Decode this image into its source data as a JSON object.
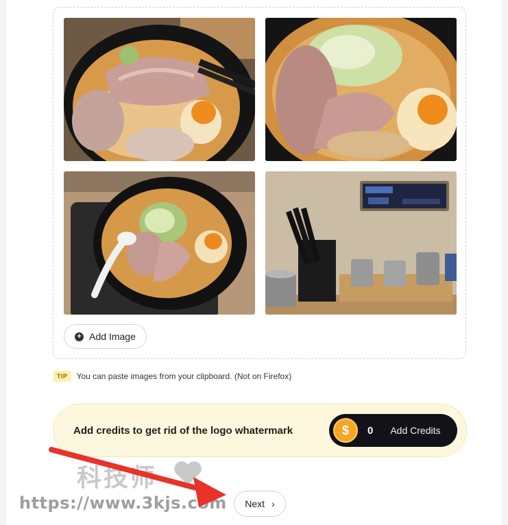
{
  "upload": {
    "photos": [
      {
        "alt": "ramen bowl with chopsticks lifting chashu"
      },
      {
        "alt": "ramen bowl with scallions and egg"
      },
      {
        "alt": "ramen bowl on black tray with spoon"
      },
      {
        "alt": "restaurant counter with chopsticks and condiment jars"
      }
    ],
    "add_image_label": "Add Image"
  },
  "tip": {
    "badge": "TIP",
    "text": "You can paste images from your clipboard. (Not on Firefox)"
  },
  "credits": {
    "message": "Add credits to get rid of the logo whatermark",
    "coin_symbol": "$",
    "count": "0",
    "add_label": "Add Credits"
  },
  "footer": {
    "next_label": "Next",
    "next_chevron": "›"
  },
  "watermark": {
    "cn": "科技师",
    "url": "https://www.3kjs.com"
  },
  "colors": {
    "accent_yellow": "#fdf8dd",
    "coin": "#f5a623",
    "pill": "#121218",
    "arrow": "#e8322a"
  }
}
